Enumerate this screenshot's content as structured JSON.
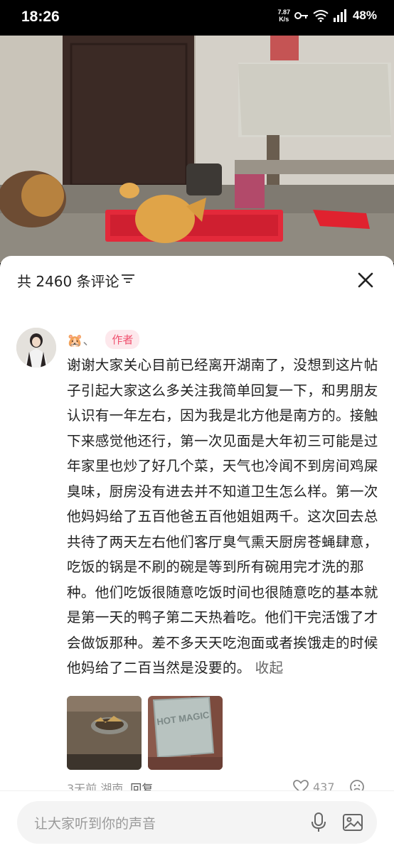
{
  "status_bar": {
    "time": "18:26",
    "net_speed_value": "7.87",
    "net_speed_unit": "K/s",
    "battery": "48%",
    "icons": [
      "key-icon",
      "wifi-icon",
      "signal-icon"
    ]
  },
  "video": {
    "description_icon": "video-frame"
  },
  "comments_header": {
    "count_label": "共 2460 条评论",
    "filter_icon": "filter-icon",
    "close_icon": "close-icon"
  },
  "comment": {
    "username": "🐹、",
    "badge": "作者",
    "text": "谢谢大家关心目前已经离开湖南了，没想到这片帖子引起大家这么多关注我简单回复一下，和男朋友认识有一年左右，因为我是北方他是南方的。接触下来感觉他还行，第一次见面是大年初三可能是过年家里也炒了好几个菜，天气也冷闻不到房间鸡屎臭味，厨房没有进去并不知道卫生怎么样。第一次他妈妈给了五百他爸五百他姐姐两千。这次回去总共待了两天左右他们客厅臭气熏天厨房苍蝇肆意，吃饭的锅是不刷的碗是等到所有碗用完才洗的那种。他们吃饭很随意吃饭时间也很随意吃的基本就是第一天的鸭子第二天热着吃。他们干完活饿了才会做饭那种。差不多天天吃泡面或者挨饿走的时候他妈给了二百当然是没要的。",
    "collapse_label": "收起",
    "time_location": "3天前 湖南",
    "reply_label": "回复",
    "likes": "437",
    "thumb_text": "HOT MAGIC"
  },
  "input_bar": {
    "placeholder": "让大家听到你的声音",
    "mic_icon": "mic-icon",
    "image_icon": "image-icon"
  }
}
